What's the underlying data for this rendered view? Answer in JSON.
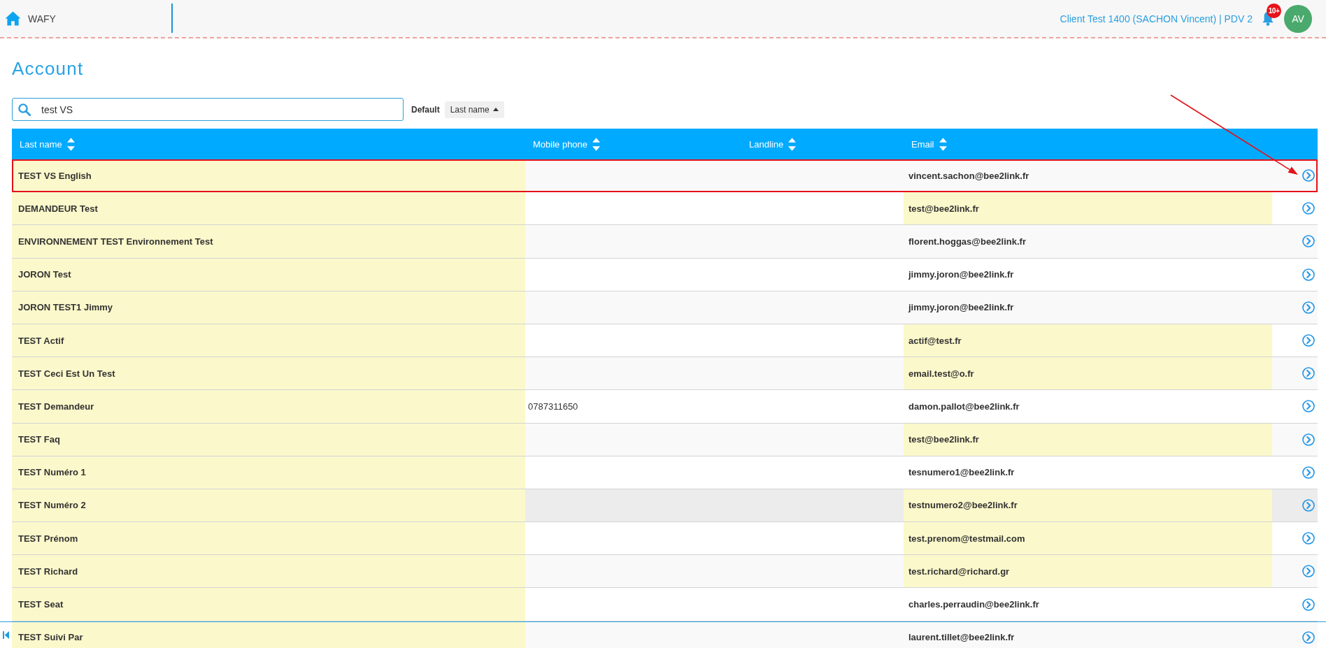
{
  "header": {
    "app_name": "WAFY",
    "context": "Client Test 1400 (SACHON Vincent) | PDV 2",
    "notification_badge": "10+",
    "avatar_initials": "AV"
  },
  "page": {
    "title": "Account"
  },
  "search": {
    "value": "test VS"
  },
  "sort": {
    "label": "Default",
    "field": "Last name",
    "ascending": true
  },
  "table": {
    "columns": [
      "Last name",
      "Mobile phone",
      "Landline",
      "Email"
    ],
    "rows": [
      {
        "last_name": "TEST VS English",
        "last_name_highlighted": true,
        "email": "vincent.sachon@bee2link.fr",
        "email_highlighted": false,
        "hovered": false,
        "annotated": true
      },
      {
        "last_name": "DEMANDEUR Test",
        "last_name_highlighted": true,
        "email": "test@bee2link.fr",
        "email_highlighted": true,
        "hovered": false,
        "annotated": false
      },
      {
        "last_name": "ENVIRONNEMENT TEST Environnement Test",
        "last_name_highlighted": true,
        "email": "florent.hoggas@bee2link.fr",
        "email_highlighted": false,
        "hovered": false,
        "annotated": false
      },
      {
        "last_name": "JORON Test",
        "last_name_highlighted": true,
        "email": "jimmy.joron@bee2link.fr",
        "email_highlighted": false,
        "hovered": false,
        "annotated": false
      },
      {
        "last_name": "JORON TEST1 Jimmy",
        "last_name_highlighted": true,
        "email": "jimmy.joron@bee2link.fr",
        "email_highlighted": false,
        "hovered": false,
        "annotated": false
      },
      {
        "last_name": "TEST Actif",
        "last_name_highlighted": true,
        "email": "actif@test.fr",
        "email_highlighted": true,
        "hovered": false,
        "annotated": false
      },
      {
        "last_name": "TEST Ceci Est Un Test",
        "last_name_highlighted": true,
        "email": "email.test@o.fr",
        "email_highlighted": true,
        "hovered": false,
        "annotated": false
      },
      {
        "last_name": "TEST Demandeur",
        "last_name_highlighted": true,
        "mobile_phone": "0787311650",
        "email": "damon.pallot@bee2link.fr",
        "email_highlighted": false,
        "hovered": false,
        "annotated": false
      },
      {
        "last_name": "TEST Faq",
        "last_name_highlighted": true,
        "email": "test@bee2link.fr",
        "email_highlighted": true,
        "hovered": false,
        "annotated": false
      },
      {
        "last_name": "TEST Numéro 1",
        "last_name_highlighted": true,
        "email": "tesnumero1@bee2link.fr",
        "email_highlighted": false,
        "hovered": false,
        "annotated": false
      },
      {
        "last_name": "TEST Numéro 2",
        "last_name_highlighted": true,
        "email": "testnumero2@bee2link.fr",
        "email_highlighted": true,
        "hovered": true,
        "annotated": false
      },
      {
        "last_name": "TEST Prénom",
        "last_name_highlighted": true,
        "email": "test.prenom@testmail.com",
        "email_highlighted": true,
        "hovered": false,
        "annotated": false
      },
      {
        "last_name": "TEST Richard",
        "last_name_highlighted": true,
        "email": "test.richard@richard.gr",
        "email_highlighted": true,
        "hovered": false,
        "annotated": false
      },
      {
        "last_name": "TEST Seat",
        "last_name_highlighted": true,
        "email": "charles.perraudin@bee2link.fr",
        "email_highlighted": false,
        "hovered": false,
        "annotated": false
      },
      {
        "last_name": "TEST Suivi Par",
        "last_name_highlighted": true,
        "email": "laurent.tillet@bee2link.fr",
        "email_highlighted": false,
        "hovered": false,
        "annotated": false
      }
    ]
  }
}
